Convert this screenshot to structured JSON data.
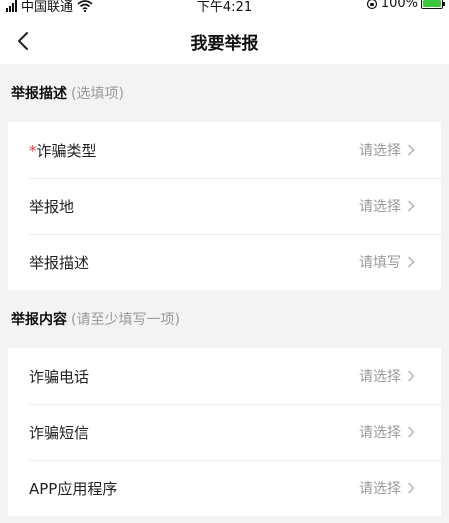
{
  "status_bar": {
    "carrier": "中国联通",
    "time": "下午4:21",
    "battery": "100%"
  },
  "nav": {
    "title": "我要举报"
  },
  "section1": {
    "title": "举报描述",
    "hint": "(选填项)",
    "rows": [
      {
        "required_mark": "*",
        "label": "诈骗类型",
        "value": "请选择"
      },
      {
        "label": "举报地",
        "value": "请选择"
      },
      {
        "label": "举报描述",
        "value": "请填写"
      }
    ]
  },
  "section2": {
    "title": "举报内容",
    "hint": "(请至少填写一项)",
    "rows": [
      {
        "label": "诈骗电话",
        "value": "请选择"
      },
      {
        "label": "诈骗短信",
        "value": "请选择"
      },
      {
        "label": "APP应用程序",
        "value": "请选择"
      }
    ]
  },
  "colors": {
    "required": "#e53935",
    "battery": "#3dc73d",
    "hint": "#9a9a9a"
  }
}
